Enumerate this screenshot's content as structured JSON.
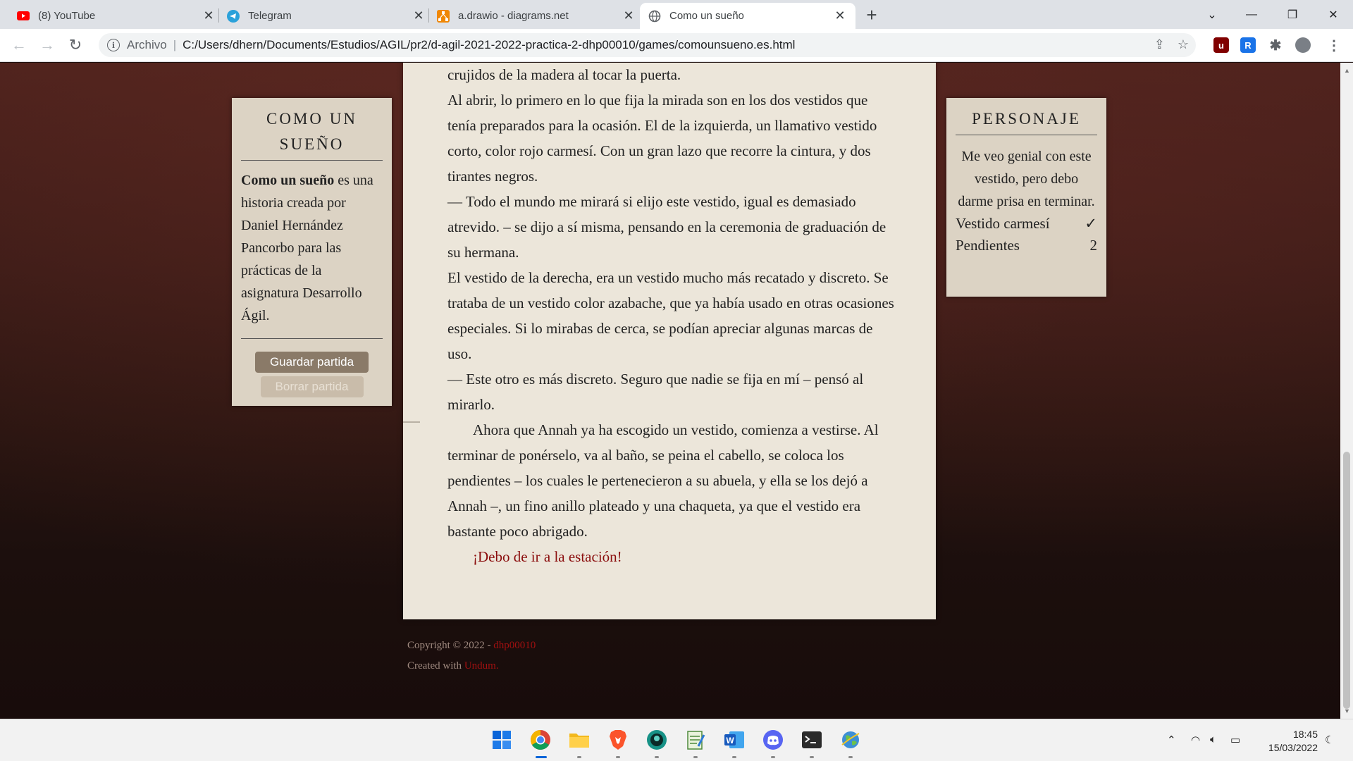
{
  "browser": {
    "tabs": [
      {
        "title": "(8) YouTube",
        "icon": "youtube-icon"
      },
      {
        "title": "Telegram",
        "icon": "telegram-icon"
      },
      {
        "title": "a.drawio - diagrams.net",
        "icon": "drawio-icon"
      },
      {
        "title": "Como un sueño",
        "icon": "globe-icon"
      }
    ],
    "address": {
      "scheme_label": "Archivo",
      "url": "C:/Users/dhern/Documents/Estudios/AGIL/pr2/d-agil-2021-2022-practica-2-dhp00010/games/comounsueno.es.html"
    }
  },
  "left_panel": {
    "title": "COMO UN SUEÑO",
    "intro_bold": "Como un sueño",
    "intro_rest": " es una historia creada por Daniel Hernández Pancorbo para las prácticas de la asignatura Desarrollo Ágil.",
    "save_label": "Guardar partida",
    "delete_label": "Borrar partida"
  },
  "right_panel": {
    "title": "PERSONAJE",
    "description": "Me veo genial con este vestido, pero debo darme prisa en terminar.",
    "qualities": [
      {
        "name": "Vestido carmesí",
        "value": "✓"
      },
      {
        "name": "Pendientes",
        "value": "2"
      }
    ]
  },
  "story": {
    "paragraphs": [
      "crujidos de la madera al tocar la puerta.",
      "Al abrir, lo primero en lo que fija la mirada son en los dos vestidos que tenía preparados para la ocasión. El de la izquierda, un llamativo vestido corto, color rojo carmesí. Con un gran lazo que recorre la cintura, y dos tirantes negros.",
      "— Todo el mundo me mirará si elijo este vestido, igual es demasiado atrevido. – se dijo a sí misma, pensando en la ceremonia de graduación de su hermana.",
      "El vestido de la derecha, era un vestido mucho más recatado y discreto. Se trataba de un vestido color azabache, que ya había usado en otras ocasiones especiales. Si lo mirabas de cerca, se podían apreciar algunas marcas de uso.",
      "— Este otro es más discreto. Seguro que nadie se fija en mí – pensó al mirarlo."
    ],
    "indented_paragraph": "Ahora que Annah ya ha escogido un vestido, comienza a vestirse. Al terminar de ponérselo, va al baño, se peina el cabello, se coloca los pendientes – los cuales le pertenecieron a su abuela, y ella se los dejó a Annah –, un fino anillo plateado y una chaqueta, ya que el vestido era bastante poco abrigado.",
    "choice_link": "¡Debo de ir a la estación!"
  },
  "footer": {
    "copyright": "Copyright © 2022 - ",
    "author_link": "dhp00010",
    "created": "Created with ",
    "engine_link": "Undum",
    "created_end": "."
  },
  "taskbar": {
    "apps": [
      "windows-start-icon",
      "chrome-icon",
      "file-explorer-icon",
      "brave-icon",
      "gitkraken-icon",
      "notepad-icon",
      "word-icon",
      "discord-icon",
      "terminal-icon",
      "earth-icon"
    ],
    "time": "18:45",
    "date": "15/03/2022"
  },
  "colors": {
    "story_link": "#8b0e0e",
    "panel_bg": "#dcd3c4",
    "paper_bg": "#ece6da"
  }
}
